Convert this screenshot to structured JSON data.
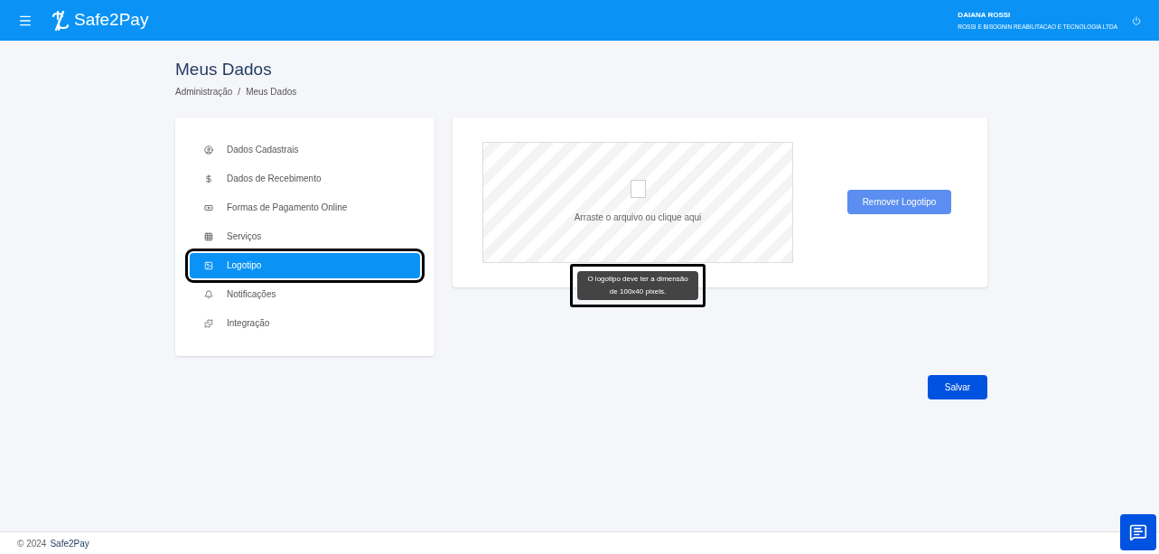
{
  "header": {
    "brand": "Safe2Pay",
    "user_name": "DAIANA ROSSI",
    "company": "ROSSI E BISOGNIN REABILITACAO E TECNOLOGIA LTDA"
  },
  "page": {
    "title": "Meus Dados",
    "breadcrumb": [
      "Administração",
      "Meus Dados"
    ],
    "breadcrumb_separator": "/"
  },
  "nav": [
    {
      "kind": "user",
      "label": "Dados Cadastrais",
      "selected": false,
      "highlighted": false
    },
    {
      "kind": "dollar",
      "label": "Dados de Recebimento",
      "selected": false,
      "highlighted": false
    },
    {
      "kind": "money",
      "label": "Formas de Pagamento Online",
      "selected": false,
      "highlighted": false
    },
    {
      "kind": "grid",
      "label": "Serviços",
      "selected": false,
      "highlighted": false
    },
    {
      "kind": "image",
      "label": "Logotipo",
      "selected": true,
      "highlighted": true
    },
    {
      "kind": "bell",
      "label": "Notificações",
      "selected": false,
      "highlighted": false
    },
    {
      "kind": "puzzle",
      "label": "Integração",
      "selected": false,
      "highlighted": false
    }
  ],
  "upload": {
    "hint": "Arraste o arquivo ou clique aqui",
    "tooltip": "O logotipo deve ter a dimensão de 100x40 pixels.",
    "tooltip_highlighted": true,
    "remove_button": "Remover Logotipo"
  },
  "save_button": "Salvar",
  "footer": {
    "copyright": "© 2024",
    "brand": "Safe2Pay"
  }
}
